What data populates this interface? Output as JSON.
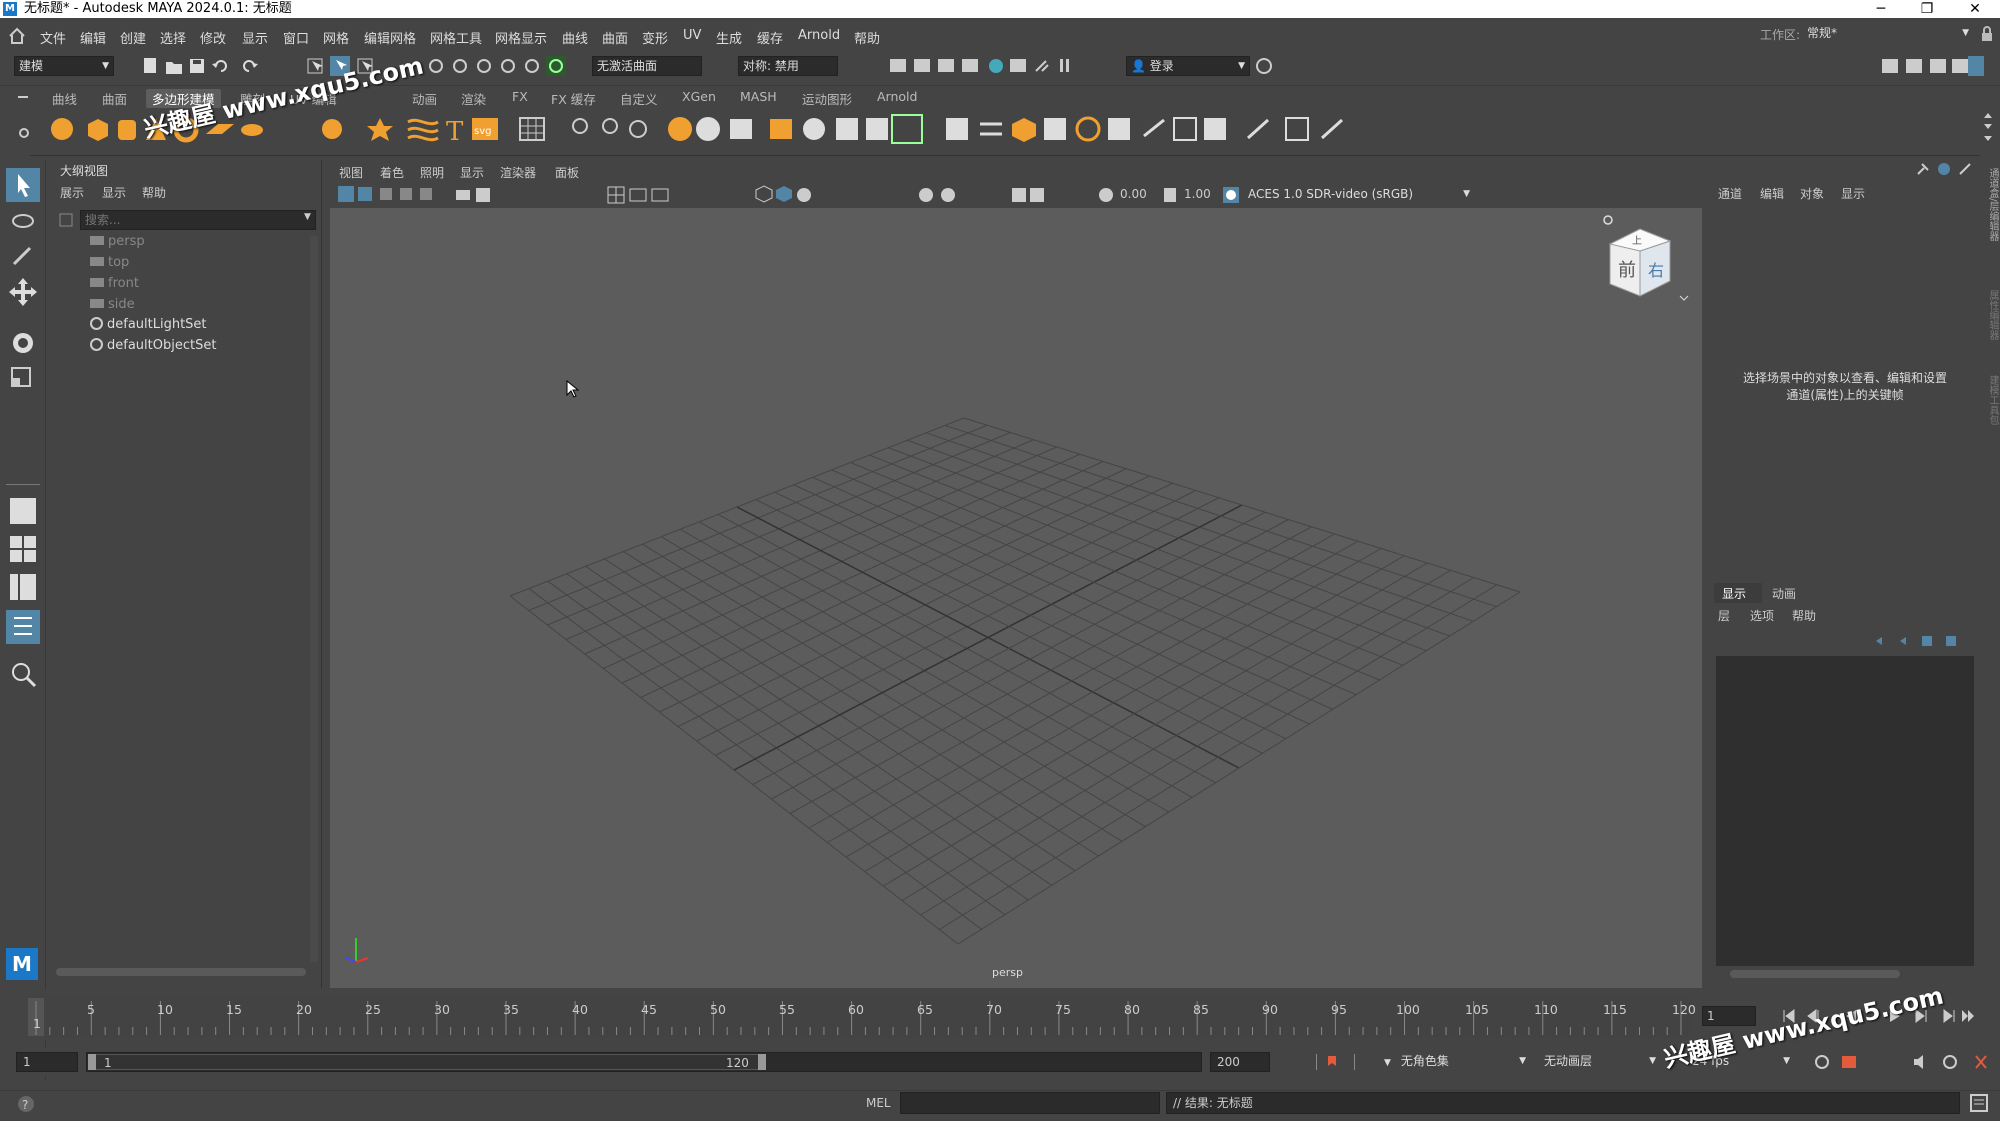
{
  "window": {
    "title": "无标题* - Autodesk MAYA 2024.0.1: 无标题",
    "logo_letter": "M",
    "controls": {
      "minimize": "─",
      "maximize": "❐",
      "close": "✕"
    }
  },
  "menubar": {
    "items": [
      "文件",
      "编辑",
      "创建",
      "选择",
      "修改",
      "显示",
      "窗口",
      "网格",
      "编辑网格",
      "网格工具",
      "网格显示",
      "曲线",
      "曲面",
      "变形",
      "UV",
      "生成",
      "缓存",
      "Arnold",
      "帮助"
    ],
    "workspace_label": "工作区:",
    "workspace_value": "常规*"
  },
  "statusline": {
    "mode": "建模",
    "live_surface": "无激活曲面",
    "symmetry": "对称: 禁用",
    "login": "登录"
  },
  "shelf": {
    "tabs": [
      "曲线",
      "曲面",
      "多边形建模",
      "雕刻",
      "UV 编辑",
      "动画",
      "渲染",
      "FX",
      "FX 缓存",
      "自定义",
      "XGen",
      "MASH",
      "运动图形",
      "Arnold"
    ],
    "active_tab": "多边形建模"
  },
  "outliner": {
    "title": "大纲视图",
    "menu": [
      "展示",
      "显示",
      "帮助"
    ],
    "search_placeholder": "搜索...",
    "items": [
      {
        "label": "persp",
        "type": "camera"
      },
      {
        "label": "top",
        "type": "camera"
      },
      {
        "label": "front",
        "type": "camera"
      },
      {
        "label": "side",
        "type": "camera"
      },
      {
        "label": "defaultLightSet",
        "type": "set"
      },
      {
        "label": "defaultObjectSet",
        "type": "set"
      }
    ]
  },
  "viewport": {
    "menu": [
      "视图",
      "着色",
      "照明",
      "显示",
      "渲染器",
      "面板"
    ],
    "exposure": "0.00",
    "gamma": "1.00",
    "color_space": "ACES 1.0 SDR-video (sRGB)",
    "camera_label": "persp",
    "viewcube_front": "前",
    "viewcube_top": "上",
    "viewcube_right": "右"
  },
  "channelbox": {
    "menu": [
      "通道",
      "编辑",
      "对象",
      "显示"
    ],
    "hint": "选择场景中的对象以查看、编辑和设置通道(属性)上的关键帧"
  },
  "layer_editor": {
    "tabs": [
      "显示",
      "动画"
    ],
    "active_tab": "显示",
    "menu": [
      "层",
      "选项",
      "帮助"
    ]
  },
  "side_tabs": [
    "通道盒/层编辑器",
    "属性编辑器",
    "建模工具包"
  ],
  "timeslider": {
    "ticks": [
      "1",
      "5",
      "10",
      "15",
      "20",
      "25",
      "30",
      "35",
      "40",
      "45",
      "50",
      "55",
      "60",
      "65",
      "70",
      "75",
      "80",
      "85",
      "90",
      "95",
      "100",
      "105",
      "110",
      "115",
      "120"
    ],
    "current_frame": "1"
  },
  "rangeslider": {
    "start": "1",
    "range_start": "1",
    "range_end": "120",
    "end": "200",
    "character_set": "无角色集",
    "anim_layer": "无动画层",
    "fps": "24 fps"
  },
  "cmdline": {
    "language": "MEL",
    "result": "// 结果: 无标题"
  },
  "watermark": "兴趣屋 www.xqu5.com",
  "colors": {
    "accent": "#5285a6",
    "viewport_bg": "#5c5c5c",
    "panel_bg": "#444444",
    "maya_blue": "#1b78c6",
    "shelf_orange": "#f0a030"
  }
}
